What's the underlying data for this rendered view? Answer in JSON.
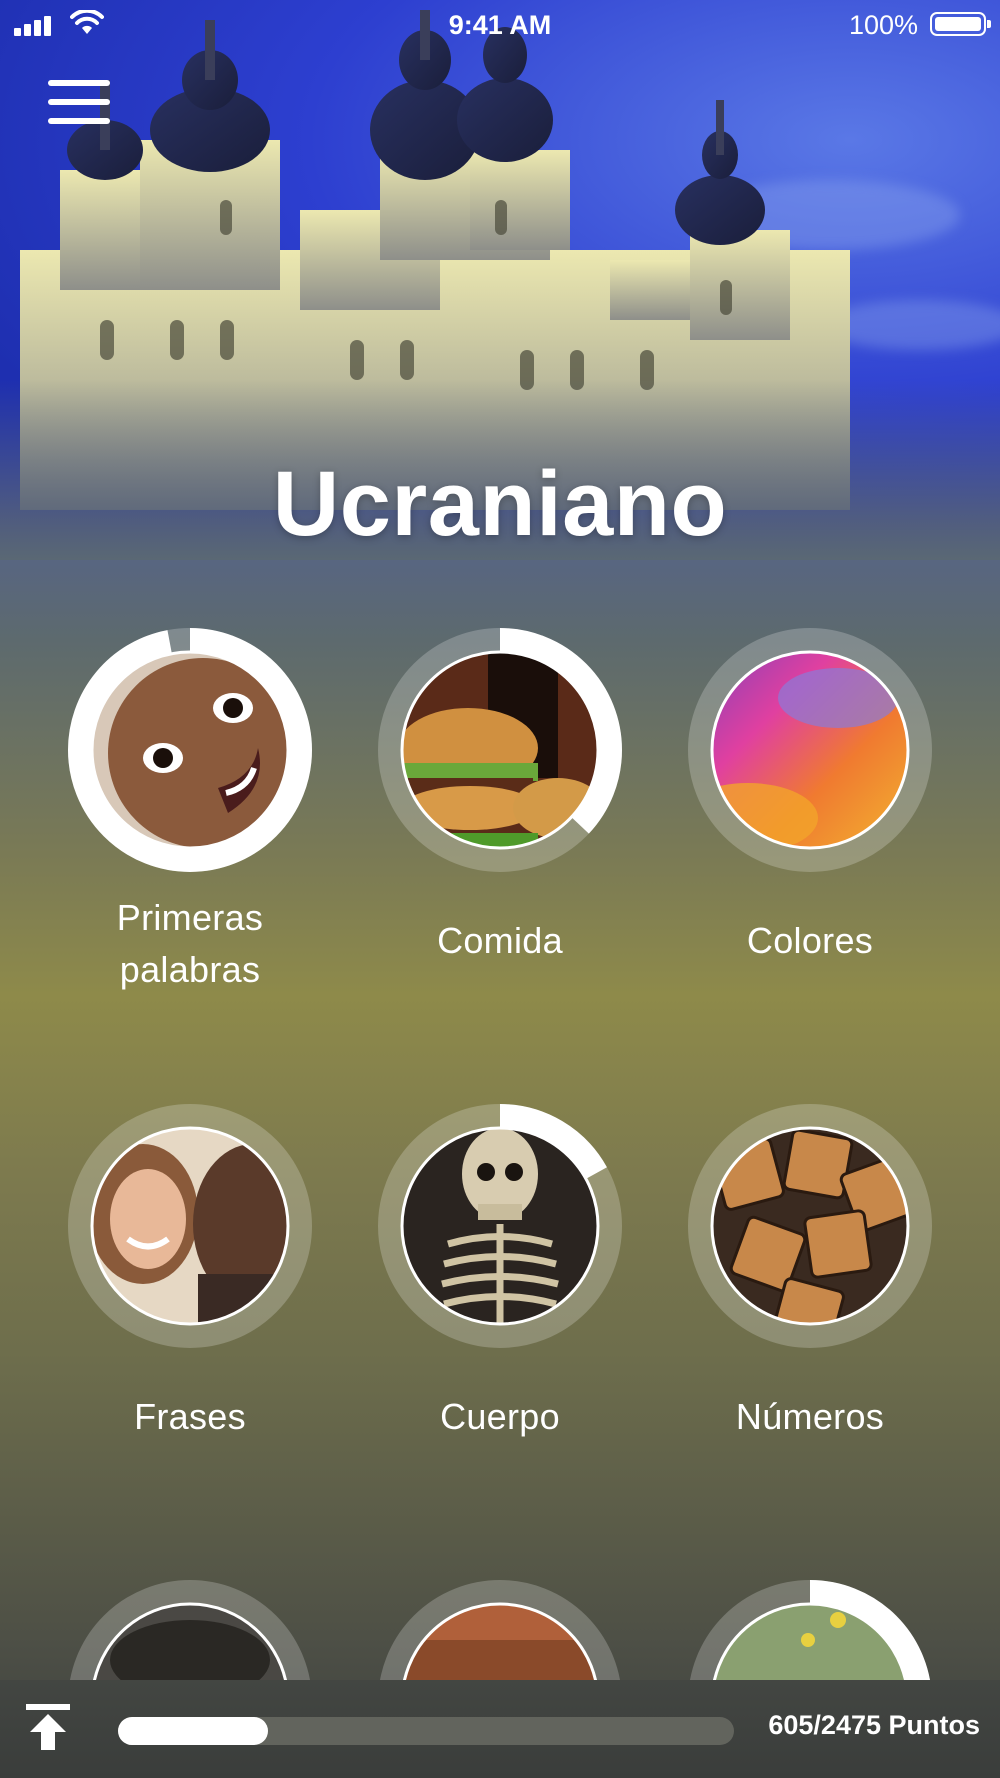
{
  "status_bar": {
    "time": "9:41 AM",
    "battery_percent": "100%"
  },
  "header": {
    "title": "Ucraniano",
    "menu_icon": "hamburger-menu-icon"
  },
  "categories_row1": [
    {
      "label": "Primeras\npalabras",
      "progress": 0.97,
      "photo": "baby-face-photo"
    },
    {
      "label": "Comida",
      "progress": 0.37,
      "photo": "burger-and-cola-photo"
    },
    {
      "label": "Colores",
      "progress": 0.0,
      "photo": "colored-powder-photo"
    }
  ],
  "categories_row2": [
    {
      "label": "Frases",
      "progress": 0.0,
      "photo": "couple-smiling-photo"
    },
    {
      "label": "Cuerpo",
      "progress": 0.17,
      "photo": "skeleton-photo"
    },
    {
      "label": "Números",
      "progress": 0.0,
      "photo": "wooden-numbers-photo"
    }
  ],
  "categories_row3": [
    {
      "progress": 0.0,
      "photo": "partially-visible-photo-1"
    },
    {
      "progress": 0.0,
      "photo": "partially-visible-photo-2"
    },
    {
      "progress": 0.3,
      "photo": "partially-visible-photo-3"
    }
  ],
  "footer": {
    "points_text": "605/2475 Puntos",
    "points_progress": 0.244,
    "upload_icon": "upload-arrow-icon"
  },
  "colors": {
    "ring_fill": "#ffffff",
    "ring_track": "rgba(255,255,255,0.22)"
  }
}
